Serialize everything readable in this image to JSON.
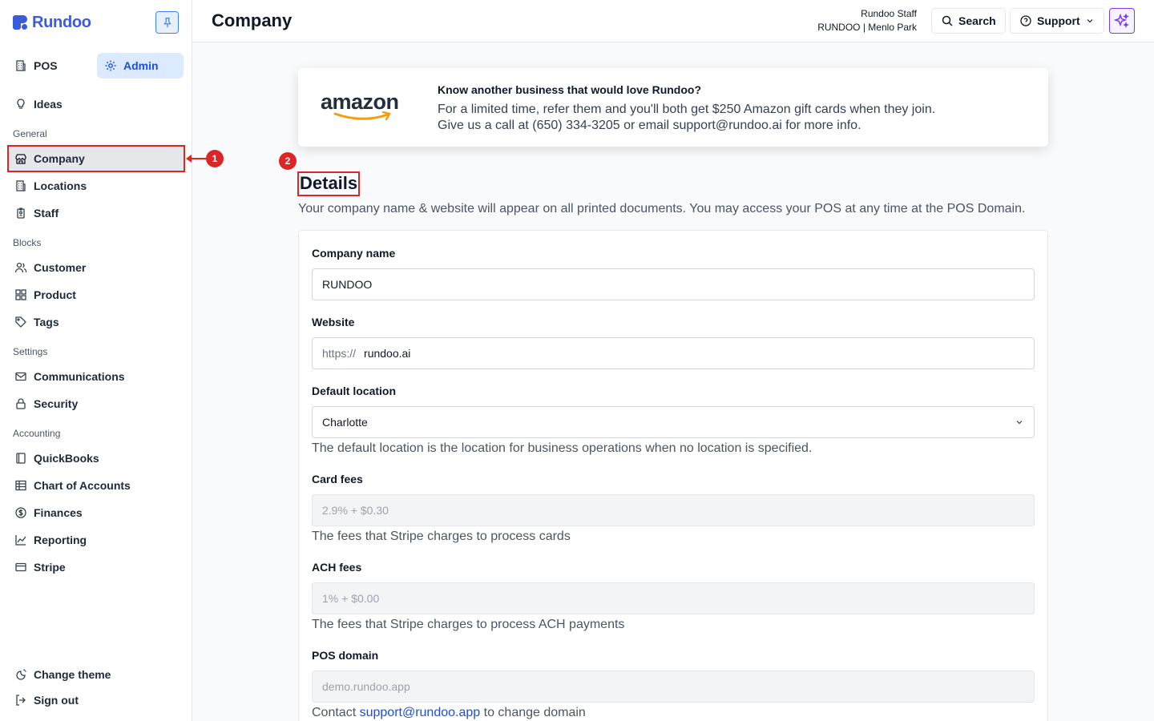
{
  "brand": {
    "name": "Rundoo"
  },
  "nav": {
    "pos": "POS",
    "admin": "Admin",
    "ideas": "Ideas",
    "sections": {
      "general": "General",
      "blocks": "Blocks",
      "settings": "Settings",
      "accounting": "Accounting"
    },
    "general": [
      "Company",
      "Locations",
      "Staff"
    ],
    "blocks": [
      "Customer",
      "Product",
      "Tags"
    ],
    "settings": [
      "Communications",
      "Security"
    ],
    "accounting": [
      "QuickBooks",
      "Chart of Accounts",
      "Finances",
      "Reporting",
      "Stripe"
    ],
    "change_theme": "Change theme",
    "sign_out": "Sign out"
  },
  "header": {
    "title": "Company",
    "user_name": "Rundoo Staff",
    "user_org": "RUNDOO | Menlo Park",
    "search": "Search",
    "support": "Support"
  },
  "promo": {
    "logo_text": "amazon",
    "title": "Know another business that would love Rundoo?",
    "line1": "For a limited time, refer them and you'll both get $250 Amazon gift cards when they join.",
    "line2": "Give us a call at (650) 334-3205 or email support@rundoo.ai for more info."
  },
  "details": {
    "title": "Details",
    "description": "Your company name & website will appear on all printed documents. You may access your POS at any time at the POS Domain.",
    "company_name_label": "Company name",
    "company_name_value": "RUNDOO",
    "website_label": "Website",
    "website_prefix": "https://",
    "website_value": "rundoo.ai",
    "default_location_label": "Default location",
    "default_location_value": "Charlotte",
    "default_location_help": "The default location is the location for business operations when no location is specified.",
    "card_fees_label": "Card fees",
    "card_fees_value": "2.9% + $0.30",
    "card_fees_help": "The fees that Stripe charges to process cards",
    "ach_fees_label": "ACH fees",
    "ach_fees_value": "1% + $0.00",
    "ach_fees_help": "The fees that Stripe charges to process ACH payments",
    "pos_domain_label": "POS domain",
    "pos_domain_value": "demo.rundoo.app",
    "pos_domain_help_prefix": "Contact",
    "pos_domain_help_link": "support@rundoo.app",
    "pos_domain_help_suffix": "to change domain"
  },
  "annotations": {
    "one": "1",
    "two": "2"
  },
  "colors": {
    "brand": "#3b5bdb",
    "accent": "#1d4ed8",
    "annotation": "#dc2626",
    "ai": "#7c3aed"
  }
}
